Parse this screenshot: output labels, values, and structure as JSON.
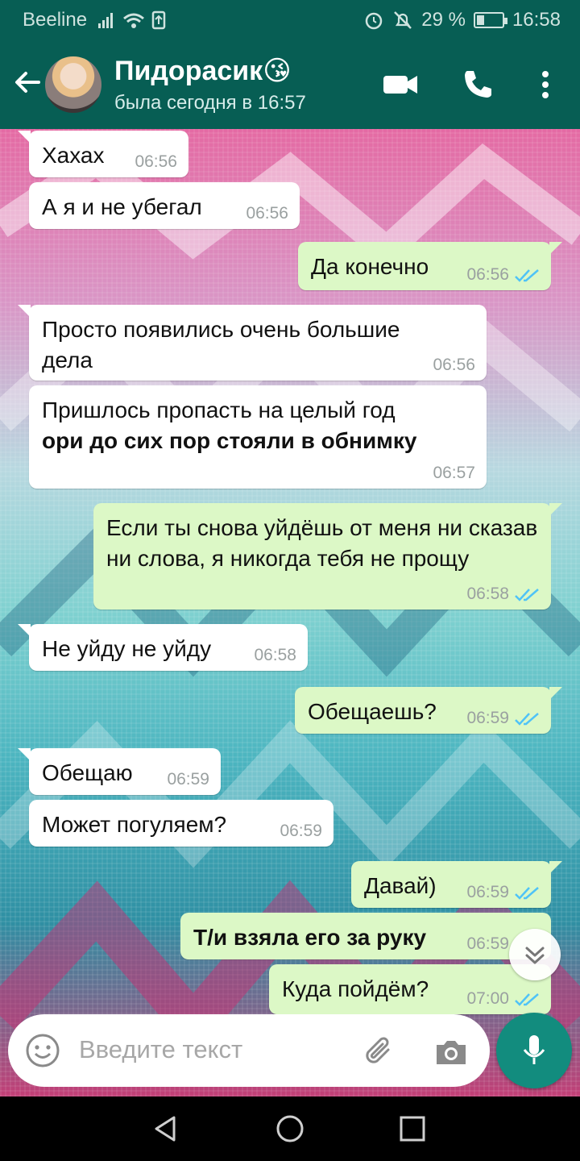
{
  "status_bar": {
    "carrier": "Beeline",
    "battery": "29 %",
    "battery_level": 0.29,
    "time": "16:58"
  },
  "header": {
    "contact_name": "Пидорасик😘",
    "contact_status": "была сегодня в 16:57"
  },
  "messages": [
    {
      "dir": "in",
      "text": "Хахах",
      "time": "06:56"
    },
    {
      "dir": "in",
      "text": "А я и не убегал",
      "time": "06:56"
    },
    {
      "dir": "out",
      "text": "Да конечно",
      "time": "06:56"
    },
    {
      "dir": "in",
      "text": "Просто появились очень большие дела",
      "time": "06:56"
    },
    {
      "dir": "in",
      "text": "Пришлось пропасть на целый год",
      "bold": "ори до сих пор стояли в обнимку",
      "time": "06:57"
    },
    {
      "dir": "out",
      "text": "Если ты снова уйдёшь от меня ни сказав ни слова, я никогда тебя не прощу",
      "time": "06:58"
    },
    {
      "dir": "in",
      "text": "Не уйду не уйду",
      "time": "06:58"
    },
    {
      "dir": "out",
      "text": "Обещаешь?",
      "time": "06:59"
    },
    {
      "dir": "in",
      "text": "Обещаю",
      "time": "06:59"
    },
    {
      "dir": "in",
      "text": "Может погуляем?",
      "time": "06:59"
    },
    {
      "dir": "out",
      "text": "Давай)",
      "time": "06:59"
    },
    {
      "dir": "out",
      "text": "Т/и взяла его за руку",
      "time": "06:59"
    },
    {
      "dir": "out",
      "text": "Куда пойдём?",
      "time": "07:00"
    }
  ],
  "input": {
    "placeholder": "Введите текст"
  },
  "colors": {
    "header": "#075e54",
    "outgoing_bubble": "#dcf8c6",
    "incoming_bubble": "#ffffff",
    "read_tick": "#4fc3f7",
    "mic_button": "#128c7e"
  }
}
